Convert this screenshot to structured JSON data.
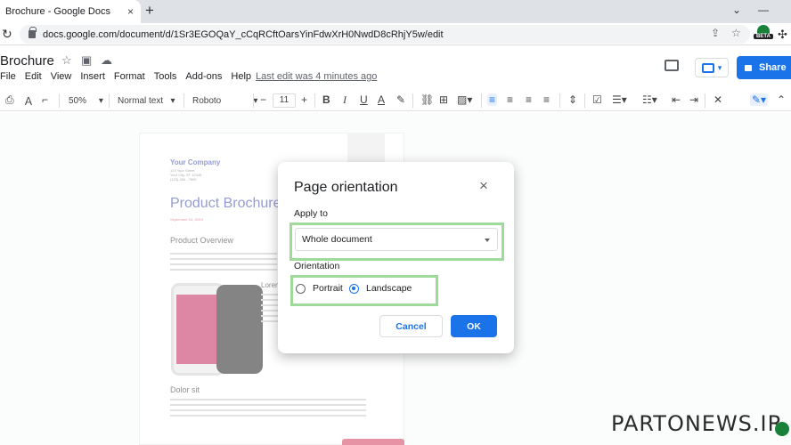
{
  "browser": {
    "tab_title": "Brochure - Google Docs",
    "tab_close": "×",
    "new_tab": "+",
    "url": "docs.google.com/document/d/1Sr3EGOQaY_cCqRCftOarsYinFdwXrH0NwdD8cRhjY5w/edit",
    "extension_badge": "BETA"
  },
  "docs": {
    "title": "Brochure",
    "menus": [
      "File",
      "Edit",
      "View",
      "Insert",
      "Format",
      "Tools",
      "Add-ons",
      "Help"
    ],
    "last_edit": "Last edit was 4 minutes ago",
    "share_label": "Share"
  },
  "toolbar": {
    "zoom": "50%",
    "style": "Normal text",
    "font": "Roboto",
    "font_size": "11",
    "minus": "−",
    "plus": "+",
    "bold": "B",
    "italic": "I",
    "underline": "U",
    "text_color": "A"
  },
  "document": {
    "company": "Your Company",
    "address": [
      "123 Your Street",
      "Your City, ST 12345",
      "(123) 456 - 7890"
    ],
    "heading": "Product Brochure",
    "date": "September 04, 20XX",
    "overview": "Product Overview",
    "lorem_heading": "Lorem",
    "dolor_heading": "Dolor sit"
  },
  "dialog": {
    "title": "Page orientation",
    "close": "×",
    "apply_to_label": "Apply to",
    "apply_to_value": "Whole document",
    "orientation_label": "Orientation",
    "portrait_label": "Portrait",
    "landscape_label": "Landscape",
    "selected_orientation": "Landscape",
    "cancel_label": "Cancel",
    "ok_label": "OK"
  },
  "colors": {
    "accent": "#1a73e8",
    "highlight": "#9edb9b",
    "brochure_blue": "#3f4bb0",
    "brochure_pink": "#d13b5b"
  },
  "watermark": "PARTONEWS.IR"
}
